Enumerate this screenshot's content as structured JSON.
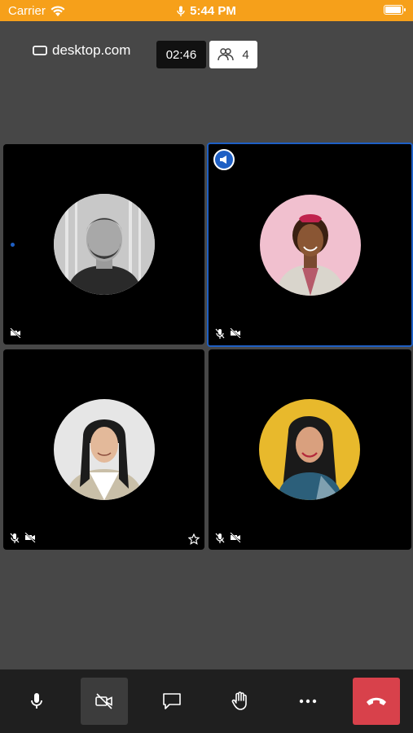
{
  "status_bar": {
    "carrier": "Carrier",
    "time": "5:44 PM"
  },
  "header": {
    "logo_text": "desktop.com",
    "timer": "02:46",
    "participant_count": "4"
  },
  "tiles": [
    {
      "name": "participant-1",
      "mic_muted": false,
      "camera_off": true,
      "has_star": false
    },
    {
      "name": "participant-2",
      "mic_muted": true,
      "camera_off": true,
      "active_speaker": true
    },
    {
      "name": "participant-3",
      "mic_muted": true,
      "camera_off": true,
      "has_star": true
    },
    {
      "name": "participant-4",
      "mic_muted": true,
      "camera_off": true,
      "has_star": false
    }
  ],
  "toolbar": {
    "buttons": [
      "microphone-icon",
      "camera-off-icon",
      "chat-icon",
      "raise-hand-icon",
      "more-icon",
      "end-call-icon"
    ],
    "end_call_color": "#d8414b",
    "active_border_color": "#1e5fc4"
  }
}
